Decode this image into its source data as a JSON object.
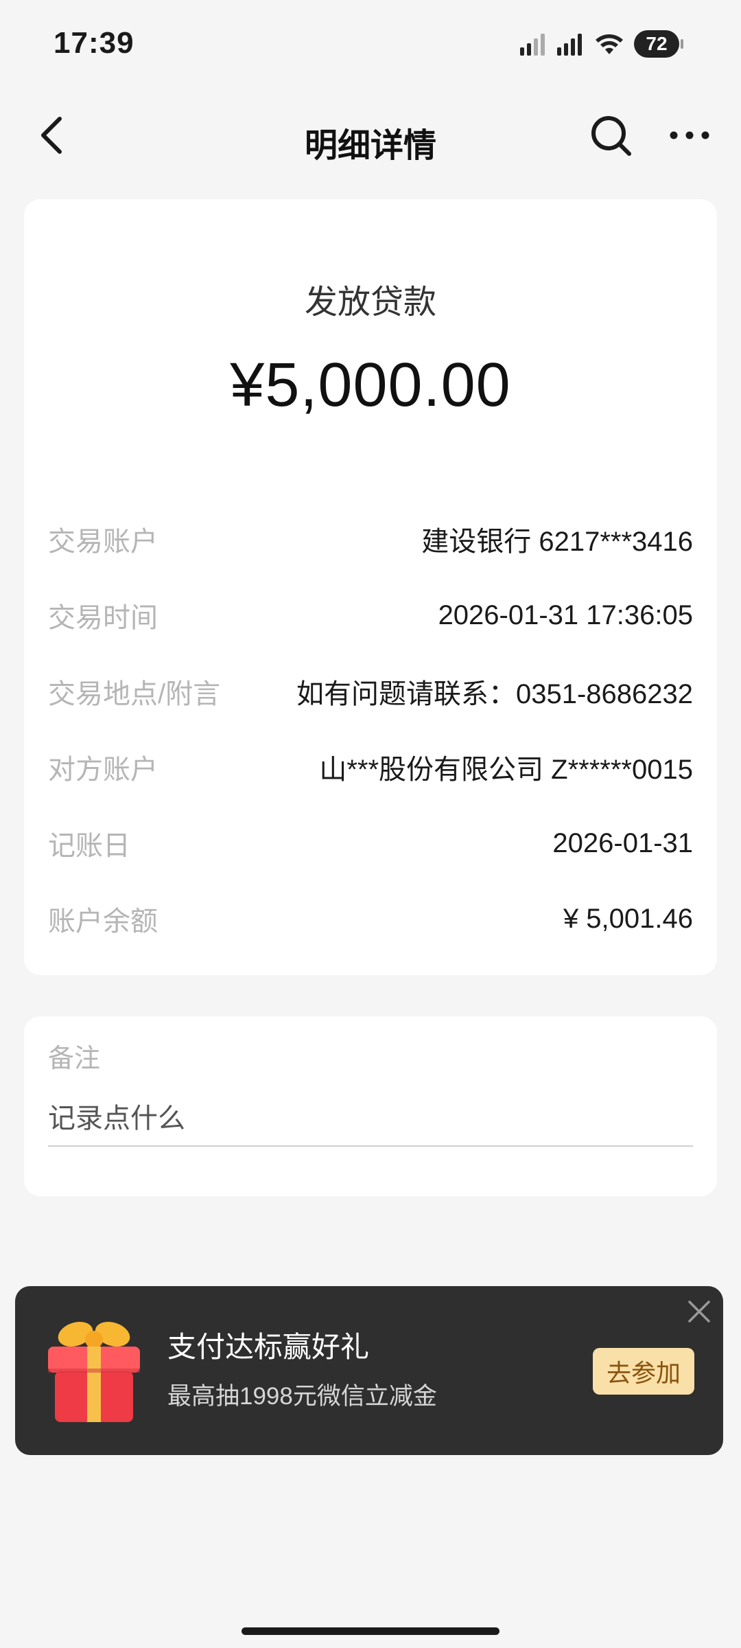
{
  "status_bar": {
    "time": "17:39",
    "battery": "72"
  },
  "nav": {
    "title": "明细详情",
    "icons": [
      "back-icon",
      "search-icon",
      "more-icon"
    ]
  },
  "transaction": {
    "type": "发放贷款",
    "amount": "¥5,000.00",
    "details": [
      {
        "label": "交易账户",
        "value": "建设银行 6217***3416"
      },
      {
        "label": "交易时间",
        "value": "2026-01-31 17:36:05"
      },
      {
        "label": "交易地点/附言",
        "value": "如有问题请联系：0351-8686232"
      },
      {
        "label": "对方账户",
        "value": "山***股份有限公司 Z******0015"
      },
      {
        "label": "记账日",
        "value": "2026-01-31"
      },
      {
        "label": "账户余额",
        "value": "¥ 5,001.46"
      }
    ]
  },
  "remark": {
    "label": "备注",
    "placeholder": "记录点什么",
    "value": ""
  },
  "promo": {
    "title": "支付达标赢好礼",
    "subtitle": "最高抽1998元微信立减金",
    "button": "去参加",
    "icons": [
      "gift-icon",
      "close-icon"
    ]
  },
  "colors": {
    "background": "#f5f5f5",
    "card": "#ffffff",
    "label_gray": "#b5b5b5",
    "banner_bg": "#2f2f2f",
    "join_button_bg": "#f9e0a8",
    "join_button_text": "#8a5410"
  }
}
